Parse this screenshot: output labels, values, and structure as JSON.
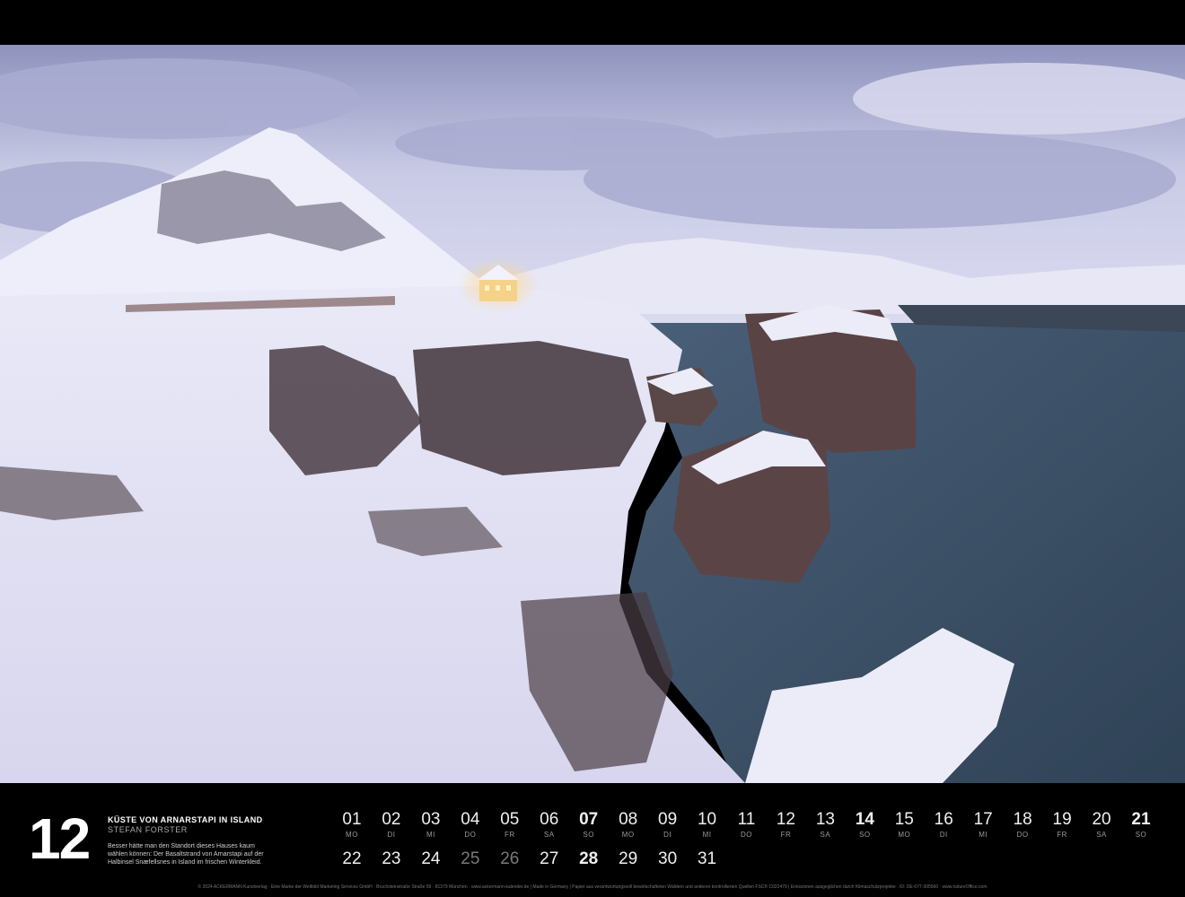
{
  "colors": {
    "background": "#000000",
    "sky": "#b9bcdc",
    "snow": "#e6e6f6",
    "water": "#3d5068",
    "rock": "#4a3b3e",
    "window_light": "#f3c26a"
  },
  "month": {
    "number": "12",
    "title": "KÜSTE VON ARNARSTAPI IN ISLAND",
    "photographer": "STEFAN FORSTER",
    "caption": "Besser hätte man den Standort dieses Hauses kaum wählen können: Der Basaltstrand von Arnarstapi auf der Halbinsel Snæfellsnes in Island im frischen Winterkleid."
  },
  "days_row1": [
    {
      "num": "01",
      "wd": "MO"
    },
    {
      "num": "02",
      "wd": "DI"
    },
    {
      "num": "03",
      "wd": "MI"
    },
    {
      "num": "04",
      "wd": "DO"
    },
    {
      "num": "05",
      "wd": "FR"
    },
    {
      "num": "06",
      "wd": "SA"
    },
    {
      "num": "07",
      "wd": "SO"
    },
    {
      "num": "08",
      "wd": "MO"
    },
    {
      "num": "09",
      "wd": "DI"
    },
    {
      "num": "10",
      "wd": "MI"
    },
    {
      "num": "11",
      "wd": "DO"
    },
    {
      "num": "12",
      "wd": "FR"
    },
    {
      "num": "13",
      "wd": "SA"
    },
    {
      "num": "14",
      "wd": "SO"
    },
    {
      "num": "15",
      "wd": "MO"
    },
    {
      "num": "16",
      "wd": "DI"
    },
    {
      "num": "17",
      "wd": "MI"
    },
    {
      "num": "18",
      "wd": "DO"
    },
    {
      "num": "19",
      "wd": "FR"
    },
    {
      "num": "20",
      "wd": "SA"
    },
    {
      "num": "21",
      "wd": "SO"
    }
  ],
  "days_row2": [
    {
      "num": "22"
    },
    {
      "num": "23"
    },
    {
      "num": "24"
    },
    {
      "num": "25"
    },
    {
      "num": "26"
    },
    {
      "num": "27"
    },
    {
      "num": "28"
    },
    {
      "num": "29"
    },
    {
      "num": "30"
    },
    {
      "num": "31"
    }
  ],
  "footer": "© 2024 ACKERMANN Kunstverlag · Eine Marke der Weltbild Marketing Services GmbH · Bruchsteinstraße Straße 59 · 81379 München · www.ackermann-kalender.de  |  Made in Germany  |  Papier aus verantwortungsvoll bewirtschafteten Wäldern und anderen kontrollierten Quellen FSC® C022479  |  Emissionen ausgeglichen durch Klimaschutzprojekte · ID: DE-077-305560 · www.natureOffice.com"
}
